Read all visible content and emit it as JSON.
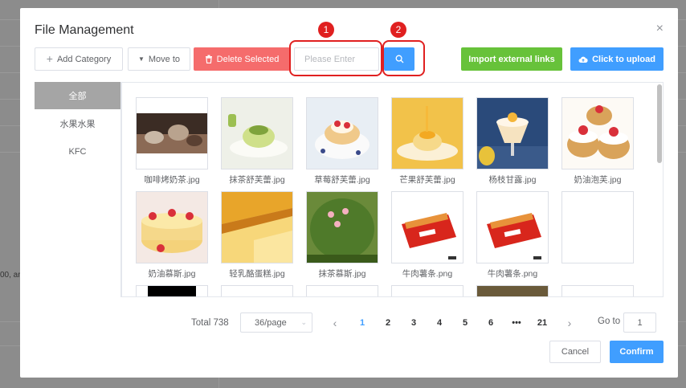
{
  "background": {
    "snippet": "00, ar"
  },
  "dialog": {
    "title": "File Management",
    "close_icon": "×"
  },
  "toolbar": {
    "add_category": "Add Category",
    "move_to": "Move to",
    "delete_selected": "Delete Selected",
    "search_placeholder": "Please Enter",
    "import_links": "Import external links",
    "upload": "Click to upload"
  },
  "annotations": {
    "badge1": "1",
    "badge2": "2"
  },
  "sidebar": {
    "items": [
      {
        "label": "全部",
        "active": true
      },
      {
        "label": "水果水果",
        "active": false
      },
      {
        "label": "KFC",
        "active": false
      }
    ]
  },
  "files": [
    {
      "name": "咖啡烤奶茶.jpg",
      "icon": "coffee-photo"
    },
    {
      "name": "抹茶舒芙蕾.jpg",
      "icon": "matcha-souffle-photo"
    },
    {
      "name": "草莓舒芙蕾.jpg",
      "icon": "strawberry-souffle-photo"
    },
    {
      "name": "芒果舒芙蕾.jpg",
      "icon": "mango-souffle-photo"
    },
    {
      "name": "杨枝甘露.jpg",
      "icon": "mango-dessert-photo"
    },
    {
      "name": "奶油泡芙.jpg",
      "icon": "cream-puff-photo"
    },
    {
      "name": "奶油慕斯.jpg",
      "icon": "cream-mousse-photo"
    },
    {
      "name": "轻乳酪蛋糕.jpg",
      "icon": "cheesecake-photo"
    },
    {
      "name": "抹茶慕斯.jpg",
      "icon": "matcha-mousse-photo"
    },
    {
      "name": "牛肉薯条.png",
      "icon": "beef-fries-photo"
    },
    {
      "name": "牛肉薯条.png",
      "icon": "beef-fries-photo"
    },
    {
      "name": "",
      "icon": "blank"
    }
  ],
  "pagination": {
    "total": "Total 738",
    "page_size": "36/page",
    "pages": [
      "1",
      "2",
      "3",
      "4",
      "5",
      "6",
      "•••",
      "21"
    ],
    "current": "1",
    "goto_label": "Go to",
    "goto_value": "1"
  },
  "footer": {
    "cancel": "Cancel",
    "confirm": "Confirm"
  },
  "colors": {
    "primary": "#409eff",
    "danger": "#f56c6c",
    "success": "#67c23a",
    "annotation": "#e02020"
  }
}
